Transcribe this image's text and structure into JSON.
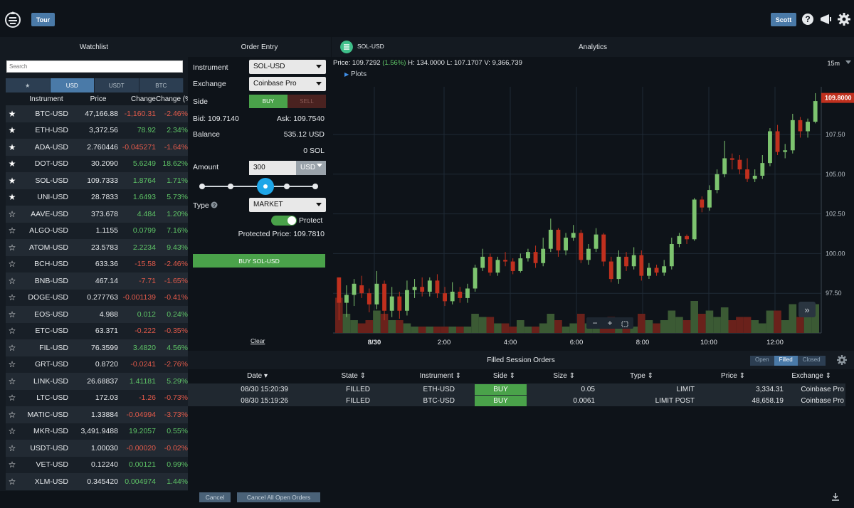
{
  "header": {
    "tour_label": "Tour",
    "user_label": "Scott"
  },
  "panels": {
    "watchlist": "Watchlist",
    "order_entry": "Order Entry",
    "analytics": "Analytics",
    "filled_orders": "Filled Session Orders"
  },
  "watchlist": {
    "search_placeholder": "Search",
    "tabs": [
      "USD",
      "USDT",
      "BTC"
    ],
    "columns": [
      "Instrument",
      "Price",
      "Change",
      "Change (%)"
    ],
    "rows": [
      {
        "starred": true,
        "instrument": "BTC-USD",
        "price": "47,166.88",
        "change": "-1,160.31",
        "pct": "-2.46%"
      },
      {
        "starred": true,
        "instrument": "ETH-USD",
        "price": "3,372.56",
        "change": "78.92",
        "pct": "2.34%"
      },
      {
        "starred": true,
        "instrument": "ADA-USD",
        "price": "2.760446",
        "change": "-0.045271",
        "pct": "-1.64%"
      },
      {
        "starred": true,
        "instrument": "DOT-USD",
        "price": "30.2090",
        "change": "5.6249",
        "pct": "18.62%"
      },
      {
        "starred": true,
        "instrument": "SOL-USD",
        "price": "109.7333",
        "change": "1.8764",
        "pct": "1.71%"
      },
      {
        "starred": true,
        "instrument": "UNI-USD",
        "price": "28.7833",
        "change": "1.6493",
        "pct": "5.73%"
      },
      {
        "starred": false,
        "instrument": "AAVE-USD",
        "price": "373.678",
        "change": "4.484",
        "pct": "1.20%"
      },
      {
        "starred": false,
        "instrument": "ALGO-USD",
        "price": "1.1155",
        "change": "0.0799",
        "pct": "7.16%"
      },
      {
        "starred": false,
        "instrument": "ATOM-USD",
        "price": "23.5783",
        "change": "2.2234",
        "pct": "9.43%"
      },
      {
        "starred": false,
        "instrument": "BCH-USD",
        "price": "633.36",
        "change": "-15.58",
        "pct": "-2.46%"
      },
      {
        "starred": false,
        "instrument": "BNB-USD",
        "price": "467.14",
        "change": "-7.71",
        "pct": "-1.65%"
      },
      {
        "starred": false,
        "instrument": "DOGE-USD",
        "price": "0.277763",
        "change": "-0.001139",
        "pct": "-0.41%"
      },
      {
        "starred": false,
        "instrument": "EOS-USD",
        "price": "4.988",
        "change": "0.012",
        "pct": "0.24%"
      },
      {
        "starred": false,
        "instrument": "ETC-USD",
        "price": "63.371",
        "change": "-0.222",
        "pct": "-0.35%"
      },
      {
        "starred": false,
        "instrument": "FIL-USD",
        "price": "76.3599",
        "change": "3.4820",
        "pct": "4.56%"
      },
      {
        "starred": false,
        "instrument": "GRT-USD",
        "price": "0.8720",
        "change": "-0.0241",
        "pct": "-2.76%"
      },
      {
        "starred": false,
        "instrument": "LINK-USD",
        "price": "26.68837",
        "change": "1.41181",
        "pct": "5.29%"
      },
      {
        "starred": false,
        "instrument": "LTC-USD",
        "price": "172.03",
        "change": "-1.26",
        "pct": "-0.73%"
      },
      {
        "starred": false,
        "instrument": "MATIC-USD",
        "price": "1.33884",
        "change": "-0.04994",
        "pct": "-3.73%"
      },
      {
        "starred": false,
        "instrument": "MKR-USD",
        "price": "3,491.9488",
        "change": "19.2057",
        "pct": "0.55%"
      },
      {
        "starred": false,
        "instrument": "USDT-USD",
        "price": "1.00030",
        "change": "-0.00020",
        "pct": "-0.02%"
      },
      {
        "starred": false,
        "instrument": "VET-USD",
        "price": "0.12240",
        "change": "0.00121",
        "pct": "0.99%"
      },
      {
        "starred": false,
        "instrument": "XLM-USD",
        "price": "0.345420",
        "change": "0.004974",
        "pct": "1.44%"
      }
    ]
  },
  "order_entry": {
    "instrument_label": "Instrument",
    "instrument_value": "SOL-USD",
    "exchange_label": "Exchange",
    "exchange_value": "Coinbase Pro",
    "side_label": "Side",
    "buy_label": "BUY",
    "sell_label": "SELL",
    "bid": "Bid: 109.7140",
    "ask": "Ask: 109.7540",
    "balance_label": "Balance",
    "balance_usd": "535.12 USD",
    "balance_sol": "0 SOL",
    "amount_label": "Amount",
    "amount_value": "300",
    "amount_unit": "USD",
    "slider_percent": 50,
    "type_label": "Type",
    "type_value": "MARKET",
    "protect_label": "Protect",
    "protected_price": "Protected Price: 109.7810",
    "submit_label": "BUY SOL-USD",
    "clear_label": "Clear"
  },
  "analytics": {
    "symbol": "SOL-USD",
    "price_text": "Price: 109.7292",
    "change_text": "(1.56%)",
    "hlv_text": "H: 134.0000  L: 107.1707  V: 9,366,739",
    "interval": "15m",
    "plots_label": "Plots",
    "last_price_label": "109.8000",
    "colors": {
      "up": "#7dc46f",
      "down": "#c0301e",
      "vol_up": "#3b5a34",
      "vol_down": "#6a211b"
    }
  },
  "chart_data": {
    "type": "candlestick",
    "y_ticks": [
      "107.50",
      "105.00",
      "102.50",
      "100.00",
      "97.50"
    ],
    "x_ticks": [
      "8/30",
      "2:00",
      "4:00",
      "6:00",
      "8:00",
      "10:00",
      "12:00"
    ],
    "ylim": [
      95.0,
      110.5
    ],
    "last_price": 109.8,
    "candles": [
      [
        98.5,
        96.9,
        95.8,
        98.5,
        0.55
      ],
      [
        96.9,
        97.4,
        96.0,
        98.0,
        0.3
      ],
      [
        97.4,
        98.1,
        96.7,
        98.4,
        0.2
      ],
      [
        98.0,
        97.5,
        97.2,
        98.6,
        0.15
      ],
      [
        97.5,
        96.8,
        96.3,
        97.8,
        0.2
      ],
      [
        96.8,
        98.1,
        96.5,
        98.9,
        0.35
      ],
      [
        98.1,
        96.4,
        95.8,
        98.3,
        0.3
      ],
      [
        96.4,
        97.3,
        96.0,
        97.9,
        0.2
      ],
      [
        97.3,
        96.4,
        95.9,
        97.6,
        0.2
      ],
      [
        96.4,
        97.7,
        96.1,
        98.3,
        0.15
      ],
      [
        97.7,
        97.9,
        97.2,
        98.4,
        0.1
      ],
      [
        97.9,
        97.6,
        97.3,
        98.5,
        0.1
      ],
      [
        97.6,
        98.3,
        97.3,
        98.5,
        0.1
      ],
      [
        98.3,
        97.5,
        97.2,
        98.7,
        0.1
      ],
      [
        97.5,
        97.0,
        96.7,
        97.9,
        0.1
      ],
      [
        97.0,
        97.6,
        96.8,
        98.2,
        0.1
      ],
      [
        97.6,
        97.2,
        96.9,
        97.9,
        0.1
      ],
      [
        97.2,
        97.8,
        96.9,
        98.1,
        0.1
      ],
      [
        97.8,
        99.1,
        97.6,
        99.3,
        0.3
      ],
      [
        99.1,
        99.8,
        98.9,
        100.3,
        0.25
      ],
      [
        99.8,
        98.8,
        98.6,
        100.0,
        0.25
      ],
      [
        98.8,
        99.6,
        98.6,
        99.8,
        0.15
      ],
      [
        99.6,
        99.5,
        99.2,
        100.1,
        0.15
      ],
      [
        99.5,
        98.9,
        98.7,
        99.7,
        0.1
      ],
      [
        98.9,
        99.7,
        98.8,
        100.0,
        0.2
      ],
      [
        99.7,
        100.1,
        99.5,
        100.3,
        0.1
      ],
      [
        100.1,
        99.4,
        99.1,
        100.5,
        0.1
      ],
      [
        99.4,
        100.3,
        99.2,
        101.0,
        0.15
      ],
      [
        100.3,
        101.5,
        100.1,
        102.2,
        0.3
      ],
      [
        101.5,
        100.2,
        99.8,
        101.6,
        0.2
      ],
      [
        100.2,
        101.0,
        99.9,
        101.3,
        0.1
      ],
      [
        101.0,
        101.3,
        100.8,
        101.8,
        0.15
      ],
      [
        101.3,
        99.6,
        99.4,
        101.5,
        0.3
      ],
      [
        99.6,
        100.3,
        99.3,
        100.6,
        0.15
      ],
      [
        100.3,
        101.2,
        100.1,
        101.6,
        0.1
      ],
      [
        101.2,
        99.5,
        99.2,
        101.3,
        0.2
      ],
      [
        99.5,
        98.4,
        98.2,
        99.8,
        0.25
      ],
      [
        98.4,
        99.8,
        98.1,
        100.2,
        0.2
      ],
      [
        99.8,
        99.2,
        98.9,
        100.1,
        0.1
      ],
      [
        99.2,
        99.9,
        99.0,
        100.4,
        0.1
      ],
      [
        99.9,
        98.6,
        98.3,
        100.2,
        0.3
      ],
      [
        98.6,
        99.1,
        98.4,
        99.4,
        0.2
      ],
      [
        99.1,
        98.8,
        98.6,
        99.3,
        0.15
      ],
      [
        98.8,
        99.2,
        98.6,
        99.6,
        0.2
      ],
      [
        99.2,
        100.6,
        99.0,
        101.0,
        0.35
      ],
      [
        100.6,
        101.1,
        100.4,
        101.3,
        0.25
      ],
      [
        101.1,
        100.9,
        100.6,
        101.2,
        0.2
      ],
      [
        100.9,
        103.4,
        100.8,
        103.5,
        0.5
      ],
      [
        103.4,
        102.9,
        102.6,
        103.6,
        0.3
      ],
      [
        102.9,
        104.0,
        102.7,
        104.3,
        0.35
      ],
      [
        104.0,
        105.0,
        103.8,
        105.3,
        0.25
      ],
      [
        105.0,
        106.0,
        104.8,
        107.1,
        0.4
      ],
      [
        106.0,
        105.9,
        105.3,
        106.3,
        0.2
      ],
      [
        105.9,
        105.3,
        105.0,
        106.2,
        0.25
      ],
      [
        105.3,
        104.7,
        104.5,
        106.0,
        0.25
      ],
      [
        104.7,
        104.9,
        104.5,
        105.3,
        0.2
      ],
      [
        104.9,
        105.7,
        104.7,
        106.2,
        0.15
      ],
      [
        105.7,
        107.7,
        105.5,
        107.9,
        0.35
      ],
      [
        107.7,
        106.4,
        106.2,
        108.1,
        0.35
      ],
      [
        106.4,
        106.5,
        106.0,
        106.9,
        0.2
      ],
      [
        106.5,
        108.4,
        106.3,
        108.8,
        0.45
      ],
      [
        108.4,
        107.7,
        107.3,
        108.6,
        0.25
      ],
      [
        107.7,
        108.3,
        107.3,
        108.5,
        0.4
      ],
      [
        108.3,
        109.6,
        108.2,
        110.1,
        0.45
      ]
    ]
  },
  "orders": {
    "segments": [
      "Open",
      "Filled",
      "Closed"
    ],
    "columns": [
      "Date",
      "State",
      "Instrument",
      "Side",
      "Size",
      "Type",
      "Price",
      "Exchange"
    ],
    "rows": [
      {
        "date": "08/30 15:20:39",
        "state": "FILLED",
        "instrument": "ETH-USD",
        "side": "BUY",
        "size": "0.05",
        "type": "LIMIT",
        "price": "3,334.31",
        "exchange": "Coinbase Pro"
      },
      {
        "date": "08/30 15:19:26",
        "state": "FILLED",
        "instrument": "BTC-USD",
        "side": "BUY",
        "size": "0.0061",
        "type": "LIMIT POST",
        "price": "48,658.19",
        "exchange": "Coinbase Pro"
      }
    ],
    "cancel_label": "Cancel",
    "cancel_all_label": "Cancel All Open Orders"
  }
}
